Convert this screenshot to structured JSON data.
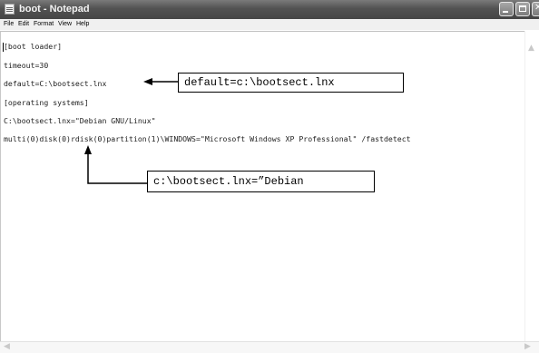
{
  "window": {
    "title": "boot - Notepad"
  },
  "menu": [
    "File",
    "Edit",
    "Format",
    "View",
    "Help"
  ],
  "editor": {
    "lines": [
      "[boot loader]",
      "timeout=30",
      "default=C:\\bootsect.lnx",
      "[operating systems]",
      "C:\\bootsect.lnx=\"Debian GNU/Linux\"",
      "multi(0)disk(0)rdisk(0)partition(1)\\WINDOWS=\"Microsoft Windows XP Professional\" /fastdetect"
    ]
  },
  "callouts": {
    "default": "default=c:\\bootsect.lnx",
    "debian": "c:\\bootsect.lnx=”Debian"
  },
  "icons": {
    "app": "notepad-icon",
    "minimize": "minimize-icon",
    "maximize": "maximize-icon",
    "close": "close-icon"
  },
  "colors": {
    "titlebar": "#525252",
    "title_text": "#f4f4f4",
    "text": "#222222"
  }
}
